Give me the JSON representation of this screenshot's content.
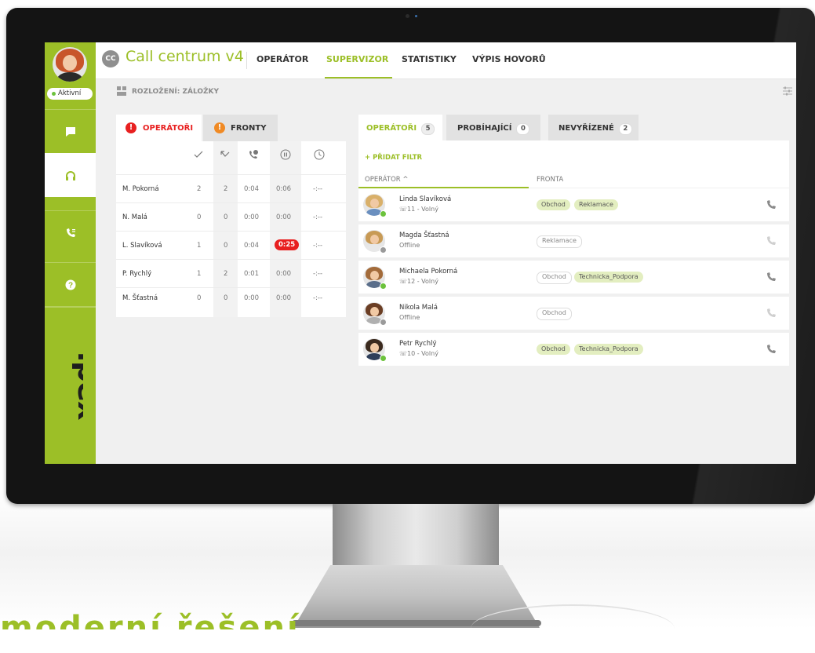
{
  "colors": {
    "brand": "#9cbf27",
    "alert": "#e82020",
    "warning": "#f08a24",
    "online": "#6cc23c",
    "offline": "#9a9a9a"
  },
  "sidebar": {
    "status": "Aktivní",
    "items": [
      {
        "icon": "chat-icon"
      },
      {
        "icon": "headset-icon",
        "active": true
      },
      {
        "icon": "phone-list-icon"
      },
      {
        "icon": "help-icon"
      }
    ],
    "logo": "ipex"
  },
  "header": {
    "badge": "CC",
    "title": "Call centrum v4",
    "tabs": [
      {
        "label": "OPERÁTOR"
      },
      {
        "label": "SUPERVIZOR",
        "active": true
      },
      {
        "label": "STATISTIKY"
      },
      {
        "label": "VÝPIS HOVORŮ"
      }
    ]
  },
  "layout": {
    "label": "ROZLOŽENÍ: ZÁLOŽKY"
  },
  "left_panel": {
    "tabs": [
      {
        "label": "OPERÁTOŘI",
        "icon": "info-icon",
        "active": true
      },
      {
        "label": "FRONTY",
        "icon": "info-icon"
      }
    ],
    "columns": [
      "check-icon",
      "missed-call-icon",
      "call-time-icon",
      "pause-icon",
      "clock-icon"
    ],
    "rows": [
      {
        "name": "M. Pokorná",
        "v1": "2",
        "v2": "2",
        "v3": "0:04",
        "v4": "0:06",
        "v5": "-:--"
      },
      {
        "name": "N. Malá",
        "v1": "0",
        "v2": "0",
        "v3": "0:00",
        "v4": "0:00",
        "v5": "-:--"
      },
      {
        "name": "L. Slavíková",
        "v1": "1",
        "v2": "0",
        "v3": "0:04",
        "v4": "0:25",
        "v5": "-:--"
      },
      {
        "name": "P. Rychlý",
        "v1": "1",
        "v2": "2",
        "v3": "0:01",
        "v4": "0:00",
        "v5": "-:--"
      },
      {
        "name": "M. Šťastná",
        "v1": "0",
        "v2": "0",
        "v3": "0:00",
        "v4": "0:00",
        "v5": "-:--"
      }
    ]
  },
  "right_panel": {
    "tabs": [
      {
        "label": "OPERÁTOŘI",
        "count": "5",
        "active": true
      },
      {
        "label": "PROBÍHAJÍCÍ",
        "count": "0"
      },
      {
        "label": "NEVYŘÍZENÉ",
        "count": "2"
      }
    ],
    "add_filter": "+ PŘIDAT FILTR",
    "col_operator": "OPERÁTOR ^",
    "col_queue": "FRONTA",
    "operators": [
      {
        "name": "Linda Slavíková",
        "status": "11 - Volný",
        "online": true,
        "queues": [
          "Obchod",
          "Reklamace"
        ],
        "queues_on": true
      },
      {
        "name": "Magda Šťastná",
        "status": "Offline",
        "online": false,
        "queues": [
          "Reklamace"
        ],
        "queues_on": false
      },
      {
        "name": "Michaela Pokorná",
        "status": "12 - Volný",
        "online": true,
        "queues": [
          "Obchod",
          "Technicka_Podpora"
        ],
        "queues_on": "mixed"
      },
      {
        "name": "Nikola Malá",
        "status": "Offline",
        "online": false,
        "queues": [
          "Obchod"
        ],
        "queues_on": false
      },
      {
        "name": "Petr Rychlý",
        "status": "10 - Volný",
        "online": true,
        "queues": [
          "Obchod",
          "Technicka_Podpora"
        ],
        "queues_on": true
      }
    ]
  },
  "footer_text": "moderní řešení"
}
